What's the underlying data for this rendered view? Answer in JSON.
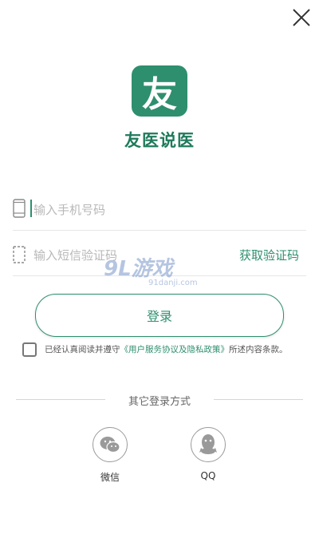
{
  "app": {
    "name": "友医说医",
    "logo_char": "友"
  },
  "form": {
    "phone_placeholder": "输入手机号码",
    "code_placeholder": "输入短信验证码",
    "get_code_label": "获取验证码",
    "login_label": "登录"
  },
  "agreement": {
    "prefix": "已经认真阅读并遵守",
    "link": "《用户服务协议及隐私政策》",
    "suffix": "所述内容条款。"
  },
  "other_login": {
    "title": "其它登录方式",
    "wechat_label": "微信",
    "qq_label": "QQ"
  },
  "watermark": {
    "text": "9L游戏",
    "sub": "91danji.com"
  },
  "colors": {
    "accent": "#2e8f6f",
    "divider": "#e6e6e6"
  }
}
